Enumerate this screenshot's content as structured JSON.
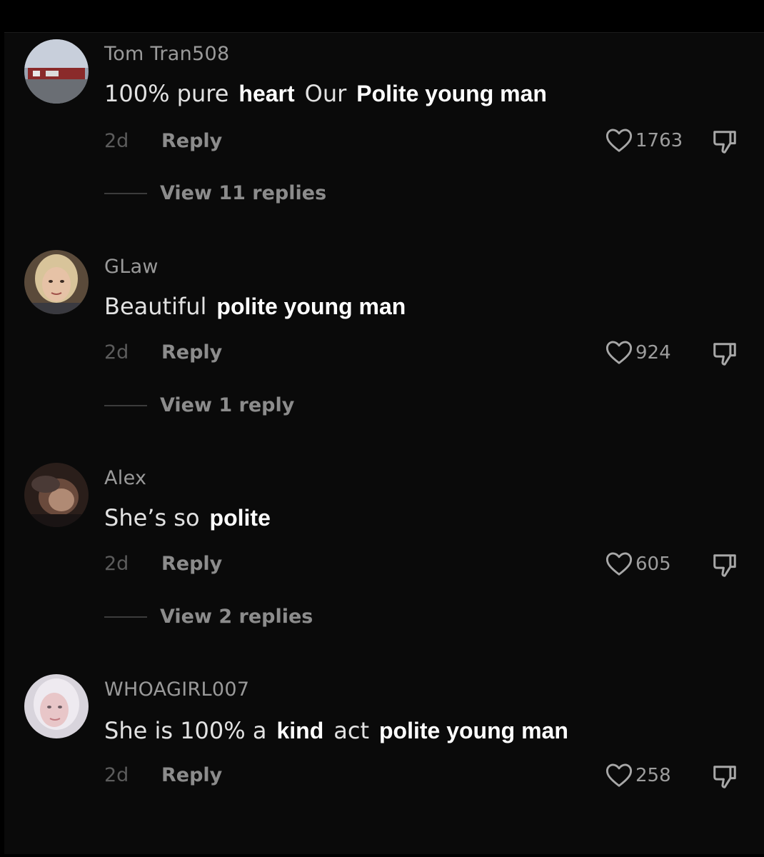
{
  "comments": [
    {
      "username": "Tom Tran508",
      "segments": [
        {
          "text": "100% pure",
          "style": "orig"
        },
        {
          "text": "heart",
          "style": "edit"
        },
        {
          "text": "Our",
          "style": "orig"
        },
        {
          "text": "Polite young man",
          "style": "edit"
        }
      ],
      "time": "2d",
      "reply_label": "Reply",
      "likes": "1763",
      "view_replies": "View 11 replies"
    },
    {
      "username": "GLaw",
      "segments": [
        {
          "text": "Beautiful",
          "style": "orig"
        },
        {
          "text": "polite young man",
          "style": "edit"
        }
      ],
      "time": "2d",
      "reply_label": "Reply",
      "likes": "924",
      "view_replies": "View 1 reply"
    },
    {
      "username": "Alex",
      "segments": [
        {
          "text": "She’s so",
          "style": "orig"
        },
        {
          "text": "polite",
          "style": "edit"
        }
      ],
      "time": "2d",
      "reply_label": "Reply",
      "likes": "605",
      "view_replies": "View 2 replies"
    },
    {
      "username": "WHOAGIRL007",
      "segments": [
        {
          "text": "She is 100% a",
          "style": "orig"
        },
        {
          "text": "kind",
          "style": "edit"
        },
        {
          "text": "act",
          "style": "orig"
        },
        {
          "text": "polite young man",
          "style": "edit"
        }
      ],
      "time": "2d",
      "reply_label": "Reply",
      "likes": "258",
      "view_replies": ""
    }
  ],
  "icons": {
    "like": "heart-outline-icon",
    "dislike": "thumbs-down-icon"
  },
  "colors": {
    "background": "#0a0a0a",
    "username": "#9a9a9a",
    "original_text": "#e2e2e2",
    "edited_text": "#ffffff",
    "muted": "#8c8c8c"
  }
}
